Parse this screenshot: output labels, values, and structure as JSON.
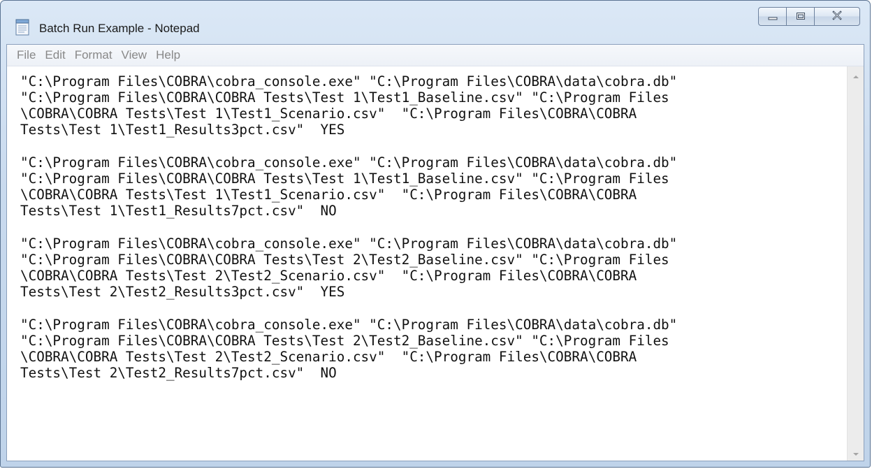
{
  "window": {
    "title": "Batch Run Example - Notepad",
    "app_icon": "notepad-icon"
  },
  "caption_buttons": {
    "minimize_icon": "minimize-icon",
    "maximize_icon": "maximize-icon",
    "close_icon": "close-icon"
  },
  "menu": {
    "items": [
      "File",
      "Edit",
      "Format",
      "View",
      "Help"
    ]
  },
  "editor": {
    "blocks": [
      [
        "\"C:\\Program Files\\COBRA\\cobra_console.exe\" \"C:\\Program Files\\COBRA\\data\\cobra.db\"",
        "\"C:\\Program Files\\COBRA\\COBRA Tests\\Test 1\\Test1_Baseline.csv\" \"C:\\Program Files",
        "\\COBRA\\COBRA Tests\\Test 1\\Test1_Scenario.csv\"  \"C:\\Program Files\\COBRA\\COBRA",
        "Tests\\Test 1\\Test1_Results3pct.csv\"  YES"
      ],
      [
        "\"C:\\Program Files\\COBRA\\cobra_console.exe\" \"C:\\Program Files\\COBRA\\data\\cobra.db\"",
        "\"C:\\Program Files\\COBRA\\COBRA Tests\\Test 1\\Test1_Baseline.csv\" \"C:\\Program Files",
        "\\COBRA\\COBRA Tests\\Test 1\\Test1_Scenario.csv\"  \"C:\\Program Files\\COBRA\\COBRA",
        "Tests\\Test 1\\Test1_Results7pct.csv\"  NO"
      ],
      [
        "\"C:\\Program Files\\COBRA\\cobra_console.exe\" \"C:\\Program Files\\COBRA\\data\\cobra.db\"",
        "\"C:\\Program Files\\COBRA\\COBRA Tests\\Test 2\\Test2_Baseline.csv\" \"C:\\Program Files",
        "\\COBRA\\COBRA Tests\\Test 2\\Test2_Scenario.csv\"  \"C:\\Program Files\\COBRA\\COBRA",
        "Tests\\Test 2\\Test2_Results3pct.csv\"  YES"
      ],
      [
        "\"C:\\Program Files\\COBRA\\cobra_console.exe\" \"C:\\Program Files\\COBRA\\data\\cobra.db\"",
        "\"C:\\Program Files\\COBRA\\COBRA Tests\\Test 2\\Test2_Baseline.csv\" \"C:\\Program Files",
        "\\COBRA\\COBRA Tests\\Test 2\\Test2_Scenario.csv\"  \"C:\\Program Files\\COBRA\\COBRA",
        "Tests\\Test 2\\Test2_Results7pct.csv\"  NO"
      ]
    ]
  },
  "scrollbar": {
    "up_icon": "scroll-up-arrow-icon",
    "down_icon": "scroll-down-arrow-icon"
  }
}
